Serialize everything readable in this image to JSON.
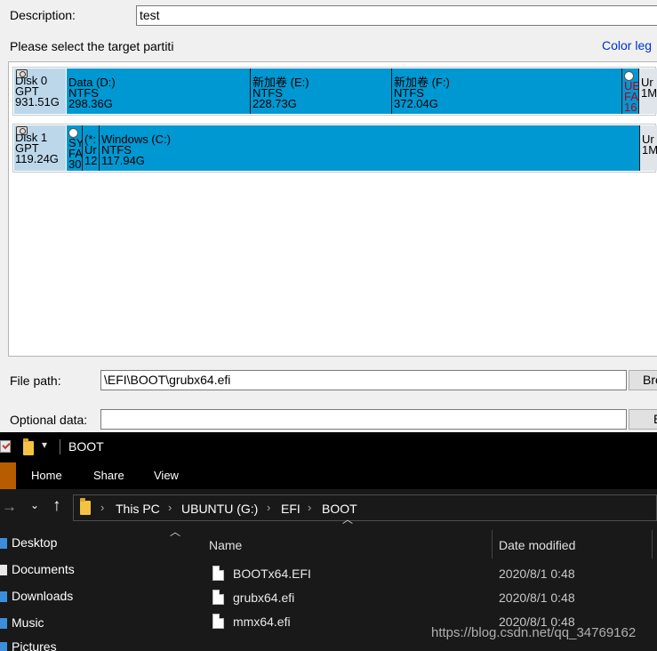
{
  "dialog": {
    "description_label": "Description:",
    "description_value": "test",
    "select_partition_text": "Please select the target partiti",
    "color_legend_link": "Color leg",
    "file_path_label": "File path:",
    "file_path_value": "\\EFI\\BOOT\\grubx64.efi",
    "browse_label": "Bro",
    "optional_data_label": "Optional data:",
    "optional_data_value": "",
    "optional_button_label": "E"
  },
  "disks": [
    {
      "name": "Disk 0",
      "style": "GPT",
      "size": "931.51G",
      "partitions": [
        {
          "l1": "Data (D:)",
          "l2": "NTFS",
          "l3": "298.36G",
          "kind": "normal"
        },
        {
          "l1": "新加卷 (E:)",
          "l2": "NTFS",
          "l3": "228.73G",
          "kind": "normal"
        },
        {
          "l1": "新加卷 (F:)",
          "l2": "NTFS",
          "l3": "372.04G",
          "kind": "normal"
        },
        {
          "l1": "UE",
          "l2": "FA",
          "l3": "16",
          "kind": "esp"
        },
        {
          "l1": "Ur",
          "l2": "1M",
          "l3": "",
          "kind": "unalloc"
        }
      ]
    },
    {
      "name": "Disk 1",
      "style": "GPT",
      "size": "119.24G",
      "partitions": [
        {
          "l1": "SY",
          "l2": "FA",
          "l3": "30",
          "kind": "sys"
        },
        {
          "l1": "(*:",
          "l2": "Ur",
          "l3": "12",
          "kind": "normal"
        },
        {
          "l1": "Windows (C:)",
          "l2": "NTFS",
          "l3": "117.94G",
          "kind": "normal"
        },
        {
          "l1": "Ur",
          "l2": "1M",
          "l3": "",
          "kind": "unalloc"
        }
      ]
    }
  ],
  "explorer": {
    "title": "BOOT",
    "ribbon_tabs": [
      "Home",
      "Share",
      "View"
    ],
    "breadcrumbs": [
      "This PC",
      "UBUNTU (G:)",
      "EFI",
      "BOOT"
    ],
    "nav_items": [
      "Desktop",
      "Documents",
      "Downloads",
      "Music",
      "Pictures"
    ],
    "columns": {
      "name": "Name",
      "date": "Date modified"
    },
    "files": [
      {
        "name": "BOOTx64.EFI",
        "date": "2020/8/1 0:48"
      },
      {
        "name": "grubx64.efi",
        "date": "2020/8/1 0:48"
      },
      {
        "name": "mmx64.efi",
        "date": "2020/8/1 0:48"
      }
    ]
  },
  "watermark": "https://blog.csdn.net/qq_34769162"
}
